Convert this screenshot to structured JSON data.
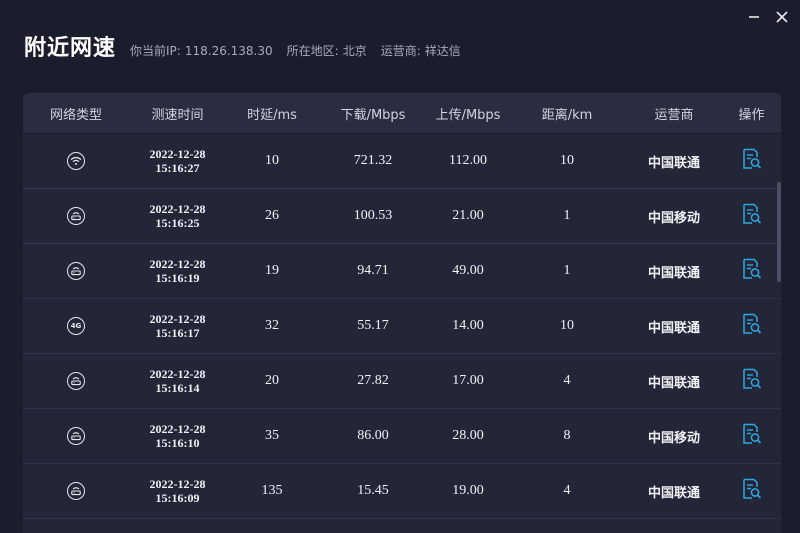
{
  "window": {
    "title": "附近网速",
    "ip_label": "你当前IP:",
    "ip_value": "118.26.138.30",
    "region_label": "所在地区:",
    "region_value": "北京",
    "isp_label": "运营商:",
    "isp_value": "祥达信"
  },
  "table": {
    "headers": [
      "网络类型",
      "测速时间",
      "时延/ms",
      "下载/Mbps",
      "上传/Mbps",
      "距离/km",
      "运营商",
      "操作"
    ],
    "rows": [
      {
        "net_icon": "wifi-icon",
        "date": "2022-12-28",
        "time": "15:16:27",
        "latency": "10",
        "download": "721.32",
        "upload": "112.00",
        "distance": "10",
        "isp": "中国联通"
      },
      {
        "net_icon": "broadband-icon",
        "date": "2022-12-28",
        "time": "15:16:25",
        "latency": "26",
        "download": "100.53",
        "upload": "21.00",
        "distance": "1",
        "isp": "中国移动"
      },
      {
        "net_icon": "broadband-icon",
        "date": "2022-12-28",
        "time": "15:16:19",
        "latency": "19",
        "download": "94.71",
        "upload": "49.00",
        "distance": "1",
        "isp": "中国联通"
      },
      {
        "net_icon": "4g-icon",
        "net_text": "4G",
        "date": "2022-12-28",
        "time": "15:16:17",
        "latency": "32",
        "download": "55.17",
        "upload": "14.00",
        "distance": "10",
        "isp": "中国联通"
      },
      {
        "net_icon": "broadband-icon",
        "date": "2022-12-28",
        "time": "15:16:14",
        "latency": "20",
        "download": "27.82",
        "upload": "17.00",
        "distance": "4",
        "isp": "中国联通"
      },
      {
        "net_icon": "broadband-icon",
        "date": "2022-12-28",
        "time": "15:16:10",
        "latency": "35",
        "download": "86.00",
        "upload": "28.00",
        "distance": "8",
        "isp": "中国移动"
      },
      {
        "net_icon": "broadband-icon",
        "date": "2022-12-28",
        "time": "15:16:09",
        "latency": "135",
        "download": "15.45",
        "upload": "19.00",
        "distance": "4",
        "isp": "中国联通"
      }
    ]
  },
  "colors": {
    "background": "#1b1d2c",
    "panel": "#232637",
    "header": "#2a2d40",
    "accent": "#2ea7e0"
  },
  "icons": {
    "minimize": "minimize-icon",
    "close": "close-icon",
    "operation": "report-search-icon"
  }
}
